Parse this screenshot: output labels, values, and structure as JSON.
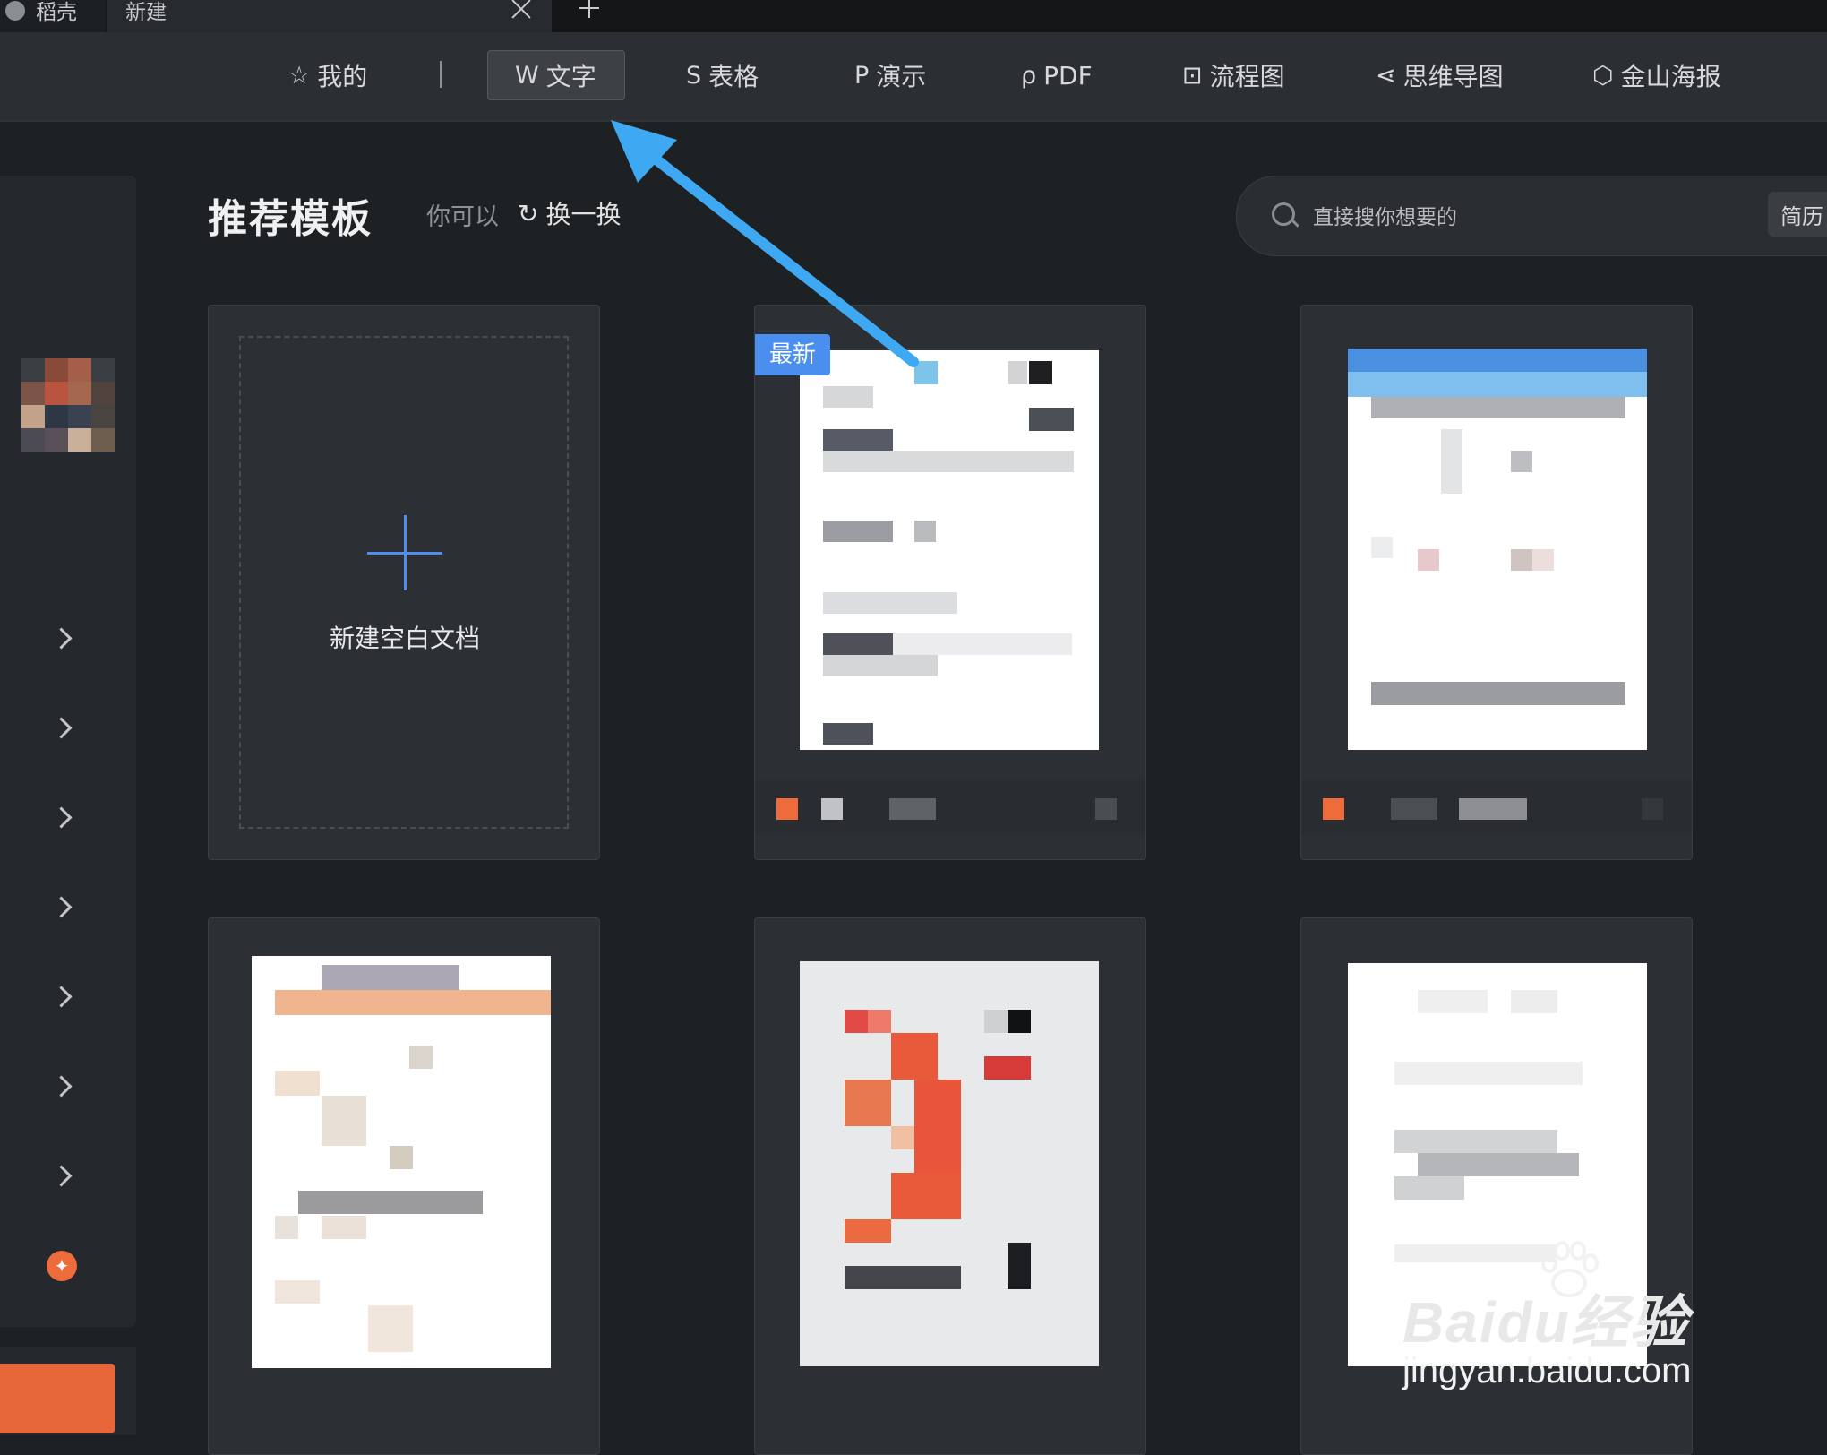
{
  "tabs": [
    {
      "label": "稻壳"
    },
    {
      "label": "新建"
    }
  ],
  "nav": {
    "items": [
      {
        "icon": "star-icon",
        "label": "我的"
      },
      {
        "icon": "word-icon",
        "label": "文字"
      },
      {
        "icon": "sheet-icon",
        "label": "表格"
      },
      {
        "icon": "presentation-icon",
        "label": "演示"
      },
      {
        "icon": "pdf-icon",
        "label": "PDF"
      },
      {
        "icon": "flowchart-icon",
        "label": "流程图"
      },
      {
        "icon": "mindmap-icon",
        "label": "思维导图"
      },
      {
        "icon": "poster-icon",
        "label": "金山海报"
      }
    ],
    "active": "文字"
  },
  "header": {
    "title": "推荐模板",
    "hint": "你可以",
    "refresh_label": "换一换"
  },
  "search": {
    "placeholder": "直接搜你想要的",
    "tag": "简历"
  },
  "cards": {
    "blank_label": "新建空白文档",
    "badge_new": "最新"
  },
  "watermark": {
    "brand": "Baidu经验",
    "url": "jingyan.baidu.com"
  },
  "colors": {
    "accent_blue": "#4a8ef0",
    "arrow": "#3ea9f2",
    "orange": "#ee6b3b",
    "background": "#1e2124"
  }
}
